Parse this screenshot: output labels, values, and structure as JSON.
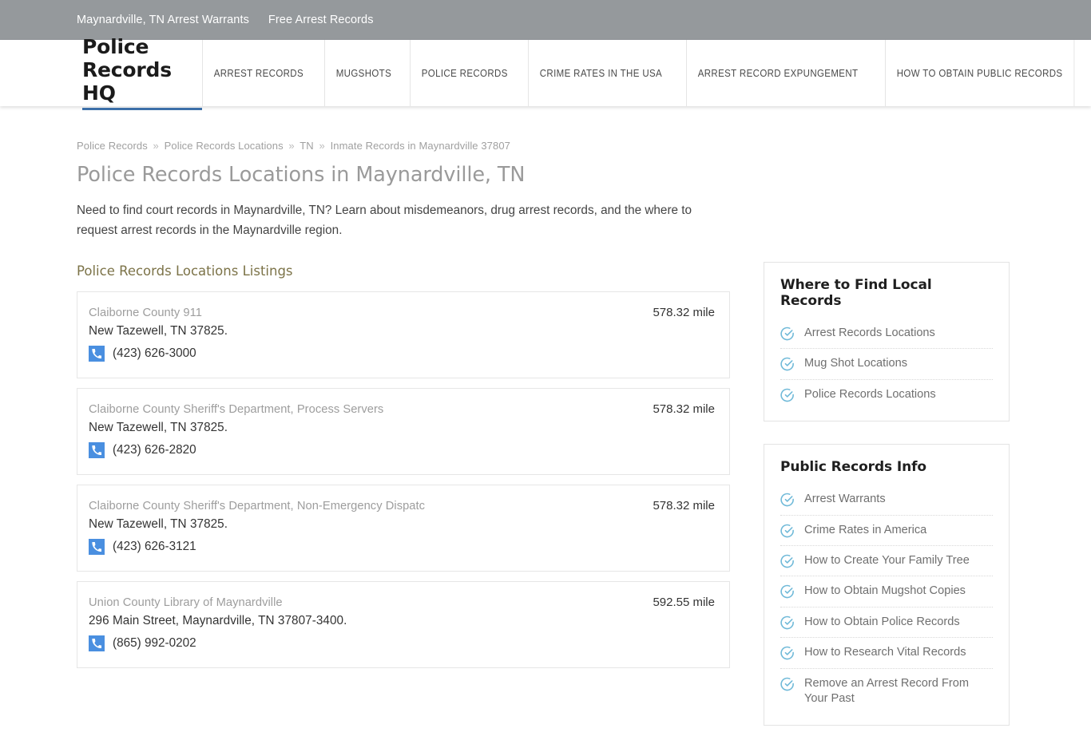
{
  "topbar": {
    "links": [
      {
        "label": "Maynardville, TN Arrest Warrants"
      },
      {
        "label": "Free Arrest Records"
      }
    ]
  },
  "header": {
    "logo": "Police Records HQ",
    "nav": [
      {
        "label": "ARREST RECORDS"
      },
      {
        "label": "MUGSHOTS"
      },
      {
        "label": "POLICE RECORDS"
      },
      {
        "label": "CRIME RATES IN THE USA"
      },
      {
        "label": "ARREST RECORD EXPUNGEMENT"
      },
      {
        "label": "HOW TO OBTAIN PUBLIC RECORDS"
      }
    ]
  },
  "breadcrumb": {
    "items": [
      {
        "label": "Police Records"
      },
      {
        "label": "Police Records Locations"
      },
      {
        "label": "TN"
      },
      {
        "label": "Inmate Records in Maynardville 37807"
      }
    ],
    "separator": "»"
  },
  "main": {
    "title": "Police Records Locations in Maynardville, TN",
    "intro": "Need to find court records in Maynardville, TN? Learn about misdemeanors, drug arrest records, and the where to request arrest records in the Maynardville region.",
    "listings_title": "Police Records Locations Listings",
    "listings": [
      {
        "name": "Claiborne County 911",
        "address": "New Tazewell, TN 37825.",
        "phone": "(423) 626-3000",
        "distance": "578.32 mile"
      },
      {
        "name": "Claiborne County Sheriff's Department, Process Servers",
        "address": "New Tazewell, TN 37825.",
        "phone": "(423) 626-2820",
        "distance": "578.32 mile"
      },
      {
        "name": "Claiborne County Sheriff's Department, Non-Emergency Dispatc",
        "address": "New Tazewell, TN 37825.",
        "phone": "(423) 626-3121",
        "distance": "578.32 mile"
      },
      {
        "name": "Union County Library of Maynardville",
        "address": "296 Main Street, Maynardville, TN 37807-3400.",
        "phone": "(865) 992-0202",
        "distance": "592.55 mile"
      }
    ]
  },
  "sidebar": {
    "widgets": [
      {
        "title": "Where to Find Local Records",
        "items": [
          {
            "label": "Arrest Records Locations"
          },
          {
            "label": "Mug Shot Locations"
          },
          {
            "label": "Police Records Locations"
          }
        ]
      },
      {
        "title": "Public Records Info",
        "items": [
          {
            "label": "Arrest Warrants"
          },
          {
            "label": "Crime Rates in America"
          },
          {
            "label": "How to Create Your Family Tree"
          },
          {
            "label": "How to Obtain Mugshot Copies"
          },
          {
            "label": "How to Obtain Police Records"
          },
          {
            "label": "How to Research Vital Records"
          },
          {
            "label": "Remove an Arrest Record From Your Past"
          }
        ]
      }
    ]
  },
  "colors": {
    "topbar_bg": "#95999c",
    "logo_underline": "#3c6fa8",
    "listings_title": "#7c7348",
    "phone_icon_bg": "#4a8fe0",
    "check_icon": "#6fb9d8",
    "page_title": "#9a9a9a"
  },
  "icons": {
    "phone": "phone-icon",
    "check": "check-circle-icon",
    "breadcrumb_sep": "chevron-double-right"
  }
}
